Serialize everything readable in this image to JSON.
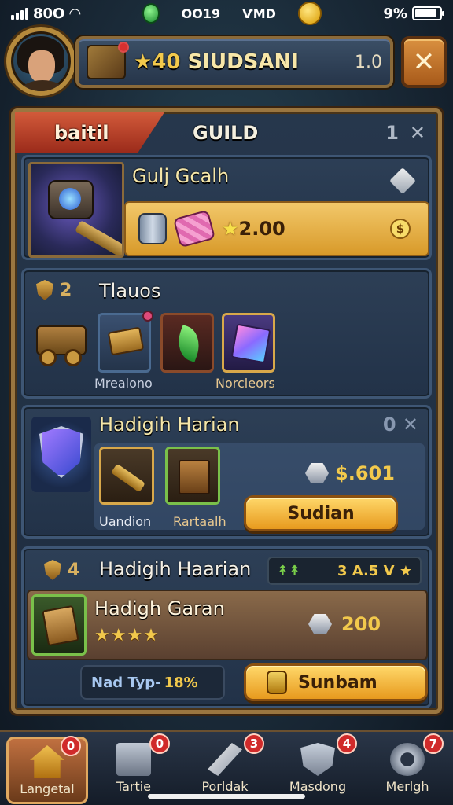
{
  "status_bar": {
    "carrier": "80О",
    "center_a": "ОО19",
    "center_b": "ѴМD",
    "battery": "9%",
    "battery_level": 0.9
  },
  "header": {
    "guild_name_star": "★40",
    "guild_name": "SIUDSANI",
    "level": "1.0",
    "close_label": "✕"
  },
  "tabs": {
    "battle": "baitil",
    "guild": "GUILD",
    "right_num": "1",
    "right_close": "✕"
  },
  "card1": {
    "title": "Gulj Gcalh",
    "reward_star": "★",
    "reward_value": "2.00",
    "dollar": "$"
  },
  "card2": {
    "badge": "2",
    "title": "Tlauos",
    "label_a": "Mrealono",
    "label_b": "Norcleors"
  },
  "card3": {
    "title": "Hadigih Harian",
    "right": "0 ✕",
    "label_a": "Uandion",
    "label_b": "Rartaalh",
    "price": "$.601",
    "button": "Sudian"
  },
  "card4": {
    "badge": "4",
    "title": "Hadigih Haarian",
    "stat_left": "↟↟",
    "stat_right": "3 A.5 V ★",
    "subtitle": "Hadigh Garan",
    "stars": "★★★★",
    "price": "200",
    "info_label": "Nad Typ-",
    "info_value": "18%",
    "button": "Sunbam"
  },
  "bottom_nav": [
    {
      "label": "Langetal",
      "badge": "0"
    },
    {
      "label": "Tartie",
      "badge": "0"
    },
    {
      "label": "Porldak",
      "badge": "3"
    },
    {
      "label": "Masdong",
      "badge": "4"
    },
    {
      "label": "Merlgh",
      "badge": "7"
    }
  ]
}
